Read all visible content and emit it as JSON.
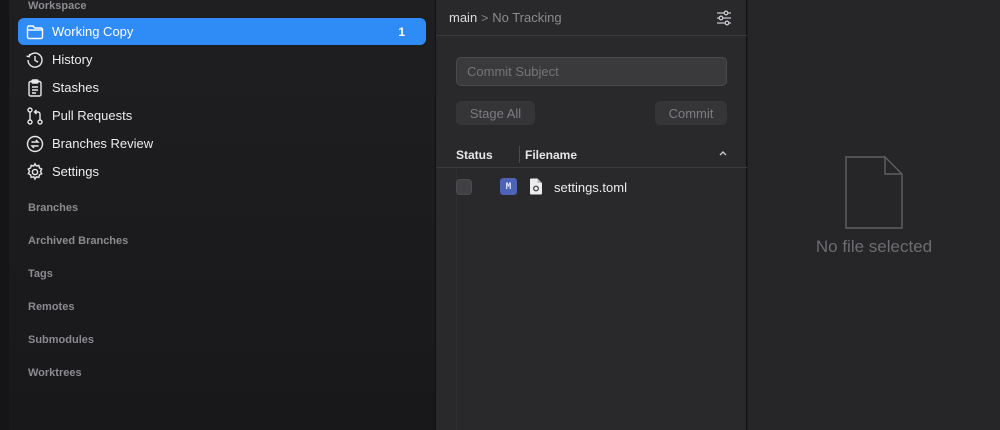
{
  "sidebar": {
    "workspace_label": "Workspace",
    "items": [
      {
        "label": "Working Copy",
        "icon": "folder-icon",
        "count": "1",
        "selected": true
      },
      {
        "label": "History",
        "icon": "history-icon"
      },
      {
        "label": "Stashes",
        "icon": "clipboard-icon"
      },
      {
        "label": "Pull Requests",
        "icon": "pull-request-icon"
      },
      {
        "label": "Branches Review",
        "icon": "branches-review-icon"
      },
      {
        "label": "Settings",
        "icon": "gear-icon"
      }
    ],
    "sections": [
      "Branches",
      "Archived Branches",
      "Tags",
      "Remotes",
      "Submodules",
      "Worktrees"
    ]
  },
  "middle": {
    "branch": "main",
    "separator": ">",
    "tracking": "No Tracking",
    "commit_placeholder": "Commit Subject",
    "stage_all_label": "Stage All",
    "commit_label": "Commit",
    "columns": {
      "status": "Status",
      "filename": "Filename"
    },
    "files": [
      {
        "status_badge": "M",
        "name": "settings.toml"
      }
    ]
  },
  "right": {
    "empty_text": "No file selected"
  },
  "colors": {
    "accent": "#2f8cf7",
    "modified_badge": "#4c63b6"
  }
}
